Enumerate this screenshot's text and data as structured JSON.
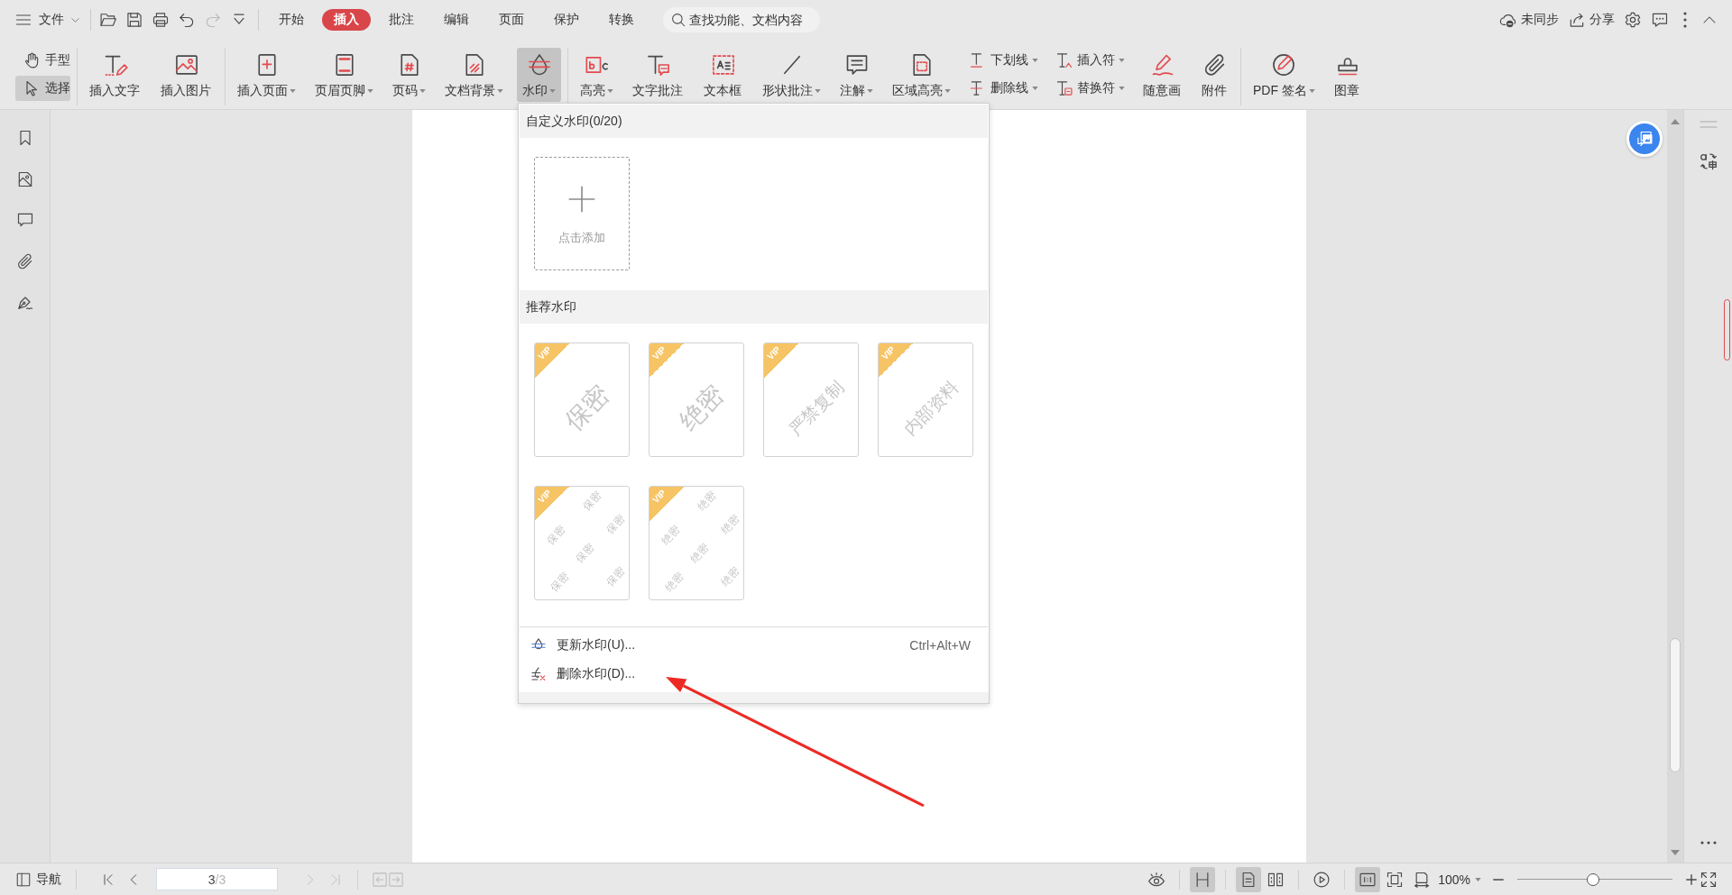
{
  "top_bar": {
    "file_label": "文件",
    "quick_tools": [
      {
        "disabled": false
      },
      {
        "disabled": false
      },
      {
        "disabled": false
      },
      {
        "disabled": false
      },
      {
        "disabled": true
      },
      {
        "disabled": false
      }
    ],
    "tabs": [
      {
        "label": "开始",
        "selected": false
      },
      {
        "label": "插入",
        "selected": true
      },
      {
        "label": "批注",
        "selected": false
      },
      {
        "label": "编辑",
        "selected": false
      },
      {
        "label": "页面",
        "selected": false
      },
      {
        "label": "保护",
        "selected": false
      },
      {
        "label": "转换",
        "selected": false
      }
    ],
    "search": {
      "placeholder": "查找功能、文档内容"
    },
    "sync_label": "未同步",
    "share_label": "分享"
  },
  "ribbon": {
    "tools": [
      {
        "label": "手型",
        "selected": false
      },
      {
        "label": "选择",
        "selected": true
      }
    ],
    "groups": [
      [
        {
          "kind": "large",
          "label": "插入文字",
          "dropdown": false,
          "selected": false
        },
        {
          "kind": "large",
          "label": "插入图片",
          "dropdown": false,
          "selected": false
        }
      ],
      [
        {
          "kind": "large",
          "label": "插入页面",
          "dropdown": true,
          "selected": false
        },
        {
          "kind": "large",
          "label": "页眉页脚",
          "dropdown": true,
          "selected": false
        },
        {
          "kind": "large",
          "label": "页码",
          "dropdown": true,
          "selected": false
        },
        {
          "kind": "large",
          "label": "文档背景",
          "dropdown": true,
          "selected": false
        },
        {
          "kind": "large",
          "label": "水印",
          "dropdown": true,
          "selected": true
        }
      ],
      [
        {
          "kind": "large",
          "label": "高亮",
          "dropdown": true,
          "selected": false
        },
        {
          "kind": "large",
          "label": "文字批注",
          "dropdown": false,
          "selected": false
        },
        {
          "kind": "large",
          "label": "文本框",
          "dropdown": false,
          "selected": false
        },
        {
          "kind": "large",
          "label": "形状批注",
          "dropdown": true,
          "selected": false
        },
        {
          "kind": "large",
          "label": "注解",
          "dropdown": true,
          "selected": false
        },
        {
          "kind": "large",
          "label": "区域高亮",
          "dropdown": true,
          "selected": false
        },
        {
          "kind": "stack",
          "items": [
            {
              "label": "下划线",
              "dropdown": true,
              "selected": false
            },
            {
              "label": "删除线",
              "dropdown": true,
              "selected": false
            }
          ]
        },
        {
          "kind": "stack",
          "items": [
            {
              "label": "插入符",
              "dropdown": true,
              "selected": false
            },
            {
              "label": "替换符",
              "dropdown": true,
              "selected": false
            }
          ]
        },
        {
          "kind": "large",
          "label": "随意画",
          "dropdown": false,
          "selected": false
        },
        {
          "kind": "large",
          "label": "附件",
          "dropdown": false,
          "selected": false
        }
      ],
      [
        {
          "kind": "large",
          "label": "PDF 签名",
          "dropdown": true,
          "selected": false
        },
        {
          "kind": "large",
          "label": "图章",
          "dropdown": false,
          "selected": false
        }
      ]
    ]
  },
  "watermark_menu": {
    "custom_title": "自定义水印(0/20)",
    "add_label": "点击添加",
    "recommended_title": "推荐水印",
    "presets": [
      {
        "kind": "single",
        "badge": "VIP",
        "text": "保密"
      },
      {
        "kind": "single",
        "badge": "VIP",
        "text": "绝密"
      },
      {
        "kind": "single",
        "badge": "VIP",
        "text": "严禁复制"
      },
      {
        "kind": "single",
        "badge": "VIP",
        "text": "内部资料"
      },
      {
        "kind": "tiled",
        "badge": "VIP",
        "texts": [
          "保密",
          "保密",
          "保密",
          "保密",
          "保密",
          "保密"
        ]
      },
      {
        "kind": "tiled",
        "badge": "VIP",
        "texts": [
          "绝密",
          "绝密",
          "绝密",
          "绝密",
          "绝密",
          "绝密"
        ]
      }
    ],
    "actions": [
      {
        "label": "更新水印(U)...",
        "shortcut": "Ctrl+Alt+W"
      },
      {
        "label": "删除水印(D)..."
      }
    ]
  },
  "status_bar": {
    "nav_label": "导航",
    "page_nav": [
      {
        "disabled": false
      },
      {
        "disabled": false
      },
      {
        "disabled": true
      },
      {
        "disabled": true
      },
      {
        "disabled": true
      },
      {
        "disabled": true
      }
    ],
    "page": {
      "current": "3",
      "total": "/3"
    },
    "view_toggles": [
      {
        "selected": false
      },
      {
        "selected": true
      },
      {
        "selected": true
      },
      {
        "selected": false
      },
      {
        "selected": false
      },
      {
        "selected": true
      },
      {
        "selected": false
      },
      {
        "selected": false
      }
    ],
    "zoom_label": "100%",
    "zoom_slider": {
      "level": 0.49
    }
  }
}
